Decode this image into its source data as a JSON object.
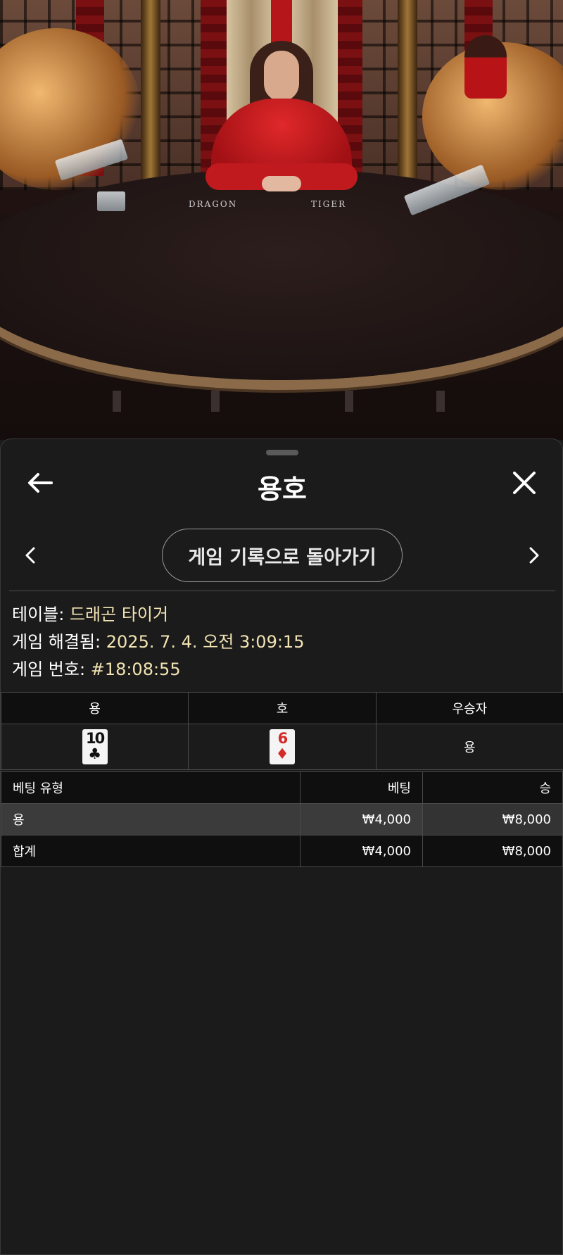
{
  "video": {
    "table_labels": {
      "dragon": "DRAGON",
      "tiger": "TIGER"
    }
  },
  "header": {
    "title": "용호",
    "back_icon": "arrow-left-icon",
    "close_icon": "close-icon"
  },
  "nav": {
    "prev_icon": "chevron-left-icon",
    "next_icon": "chevron-right-icon",
    "history_button": "게임 기록으로 돌아가기"
  },
  "details": {
    "table_label": "테이블:",
    "table_value": "드래곤 타이거",
    "resolved_label": "게임 해결됨:",
    "resolved_value": "2025. 7. 4. 오전 3:09:15",
    "game_no_label": "게임 번호:",
    "game_no_value": "#18:08:55"
  },
  "result": {
    "headers": [
      "용",
      "호",
      "우승자"
    ],
    "dragon_card": {
      "rank": "10",
      "suit": "♣",
      "color": "#111111"
    },
    "tiger_card": {
      "rank": "6",
      "suit": "♦",
      "color": "#d42a2a"
    },
    "winner": "용"
  },
  "bets": {
    "headers": [
      "베팅 유형",
      "베팅",
      "승"
    ],
    "rows": [
      {
        "type": "용",
        "bet": "₩4,000",
        "win": "₩8,000"
      }
    ],
    "total": {
      "type": "합계",
      "bet": "₩4,000",
      "win": "₩8,000"
    }
  },
  "colors": {
    "sheet_bg": "#1b1b1b",
    "value_text": "#f2e3b3",
    "header_bg": "#0f0f0f",
    "highlight_row": "#3b3b3b"
  }
}
